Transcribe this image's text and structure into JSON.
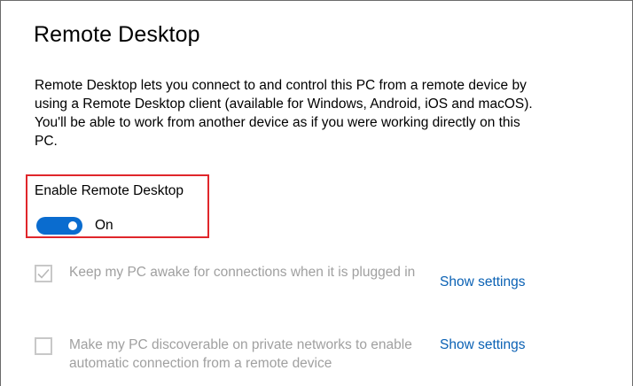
{
  "page": {
    "title": "Remote Desktop",
    "description": "Remote Desktop lets you connect to and control this PC from a remote device by using a Remote Desktop client (available for Windows, Android, iOS and macOS). You'll be able to work from another device as if you were working directly on this PC."
  },
  "enable_remote_desktop": {
    "label": "Enable Remote Desktop",
    "state_text": "On",
    "enabled": true
  },
  "options": [
    {
      "label": "Keep my PC awake for connections when it is plugged in",
      "checked": true,
      "disabled": true,
      "link_label": "Show settings"
    },
    {
      "label": "Make my PC discoverable on private networks to enable automatic connection from a remote device",
      "checked": false,
      "disabled": true,
      "link_label": "Show settings"
    }
  ],
  "colors": {
    "toggle_on": "#0a6ccf",
    "link": "#0a61b4",
    "highlight_border": "#e0262b",
    "disabled_text": "#a0a0a0"
  },
  "icons": {
    "checkmark": "checkmark-icon"
  }
}
